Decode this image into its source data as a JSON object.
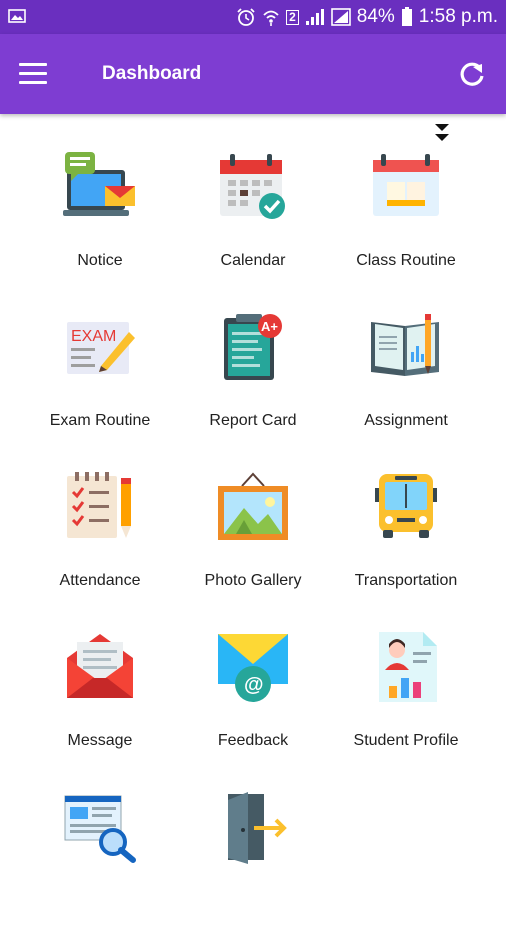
{
  "status_bar": {
    "battery": "84%",
    "time": "1:58 p.m.",
    "sim_slot": "2"
  },
  "app_bar": {
    "title": "Dashboard",
    "menu_icon": "hamburger-menu-icon",
    "refresh_icon": "refresh-icon"
  },
  "colors": {
    "app_bar": "#7e3dd2",
    "status_bar": "#6a2fbf"
  },
  "dashboard": {
    "items": [
      {
        "label": "Notice",
        "icon": "notice-icon"
      },
      {
        "label": "Calendar",
        "icon": "calendar-icon"
      },
      {
        "label": "Class Routine",
        "icon": "class-routine-icon"
      },
      {
        "label": "Exam Routine",
        "icon": "exam-routine-icon"
      },
      {
        "label": "Report Card",
        "icon": "report-card-icon"
      },
      {
        "label": "Assignment",
        "icon": "assignment-icon"
      },
      {
        "label": "Attendance",
        "icon": "attendance-icon"
      },
      {
        "label": "Photo Gallery",
        "icon": "photo-gallery-icon"
      },
      {
        "label": "Transportation",
        "icon": "transportation-icon"
      },
      {
        "label": "Message",
        "icon": "message-icon"
      },
      {
        "label": "Feedback",
        "icon": "feedback-icon"
      },
      {
        "label": "Student Profile",
        "icon": "student-profile-icon"
      },
      {
        "label": "",
        "icon": "web-search-icon"
      },
      {
        "label": "",
        "icon": "logout-door-icon"
      }
    ]
  }
}
